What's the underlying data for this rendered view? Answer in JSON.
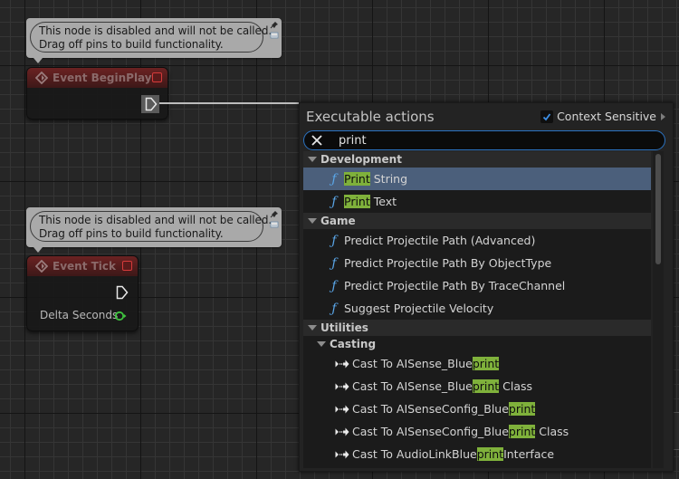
{
  "graph": {
    "comment_lines": [
      "This node is disabled and will not be called.",
      "Drag off pins to build functionality."
    ],
    "nodes": [
      {
        "title": "Event BeginPlay",
        "pins": []
      },
      {
        "title": "Event Tick",
        "pins": [
          {
            "label": "Delta Seconds",
            "type": "float"
          }
        ]
      }
    ]
  },
  "popup": {
    "title": "Executable actions",
    "context_sensitive": {
      "label": "Context Sensitive",
      "checked": true
    },
    "search": {
      "value": "print",
      "placeholder": ""
    },
    "categories": [
      {
        "name": "Development",
        "items": [
          {
            "icon": "function-icon",
            "highlight": "Print",
            "rest": " String",
            "selected": true
          },
          {
            "icon": "function-icon",
            "highlight": "Print",
            "rest": " Text",
            "selected": false
          }
        ]
      },
      {
        "name": "Game",
        "items": [
          {
            "icon": "function-icon",
            "label": "Predict Projectile Path (Advanced)"
          },
          {
            "icon": "function-icon",
            "label": "Predict Projectile Path By ObjectType"
          },
          {
            "icon": "function-icon",
            "label": "Predict Projectile Path By TraceChannel"
          },
          {
            "icon": "function-icon",
            "label": "Suggest Projectile Velocity"
          }
        ]
      },
      {
        "name": "Utilities",
        "subcategory": "Casting",
        "items": [
          {
            "icon": "cast-icon",
            "pre": "Cast To AISense_Blue",
            "highlight": "print",
            "post": ""
          },
          {
            "icon": "cast-icon",
            "pre": "Cast To AISense_Blue",
            "highlight": "print",
            "post": " Class"
          },
          {
            "icon": "cast-icon",
            "pre": "Cast To AISenseConfig_Blue",
            "highlight": "print",
            "post": ""
          },
          {
            "icon": "cast-icon",
            "pre": "Cast To AISenseConfig_Blue",
            "highlight": "print",
            "post": " Class"
          },
          {
            "icon": "cast-icon",
            "pre": "Cast To AudioLinkBlue",
            "highlight": "print",
            "post": "Interface"
          }
        ]
      }
    ]
  },
  "colors": {
    "highlight": "#7fb13b",
    "selection": "#4b5f7b",
    "function_icon": "#5aa6e8",
    "search_border": "#2b73c2",
    "event_header": "#6b2222",
    "float_pin": "#3fc43f"
  }
}
